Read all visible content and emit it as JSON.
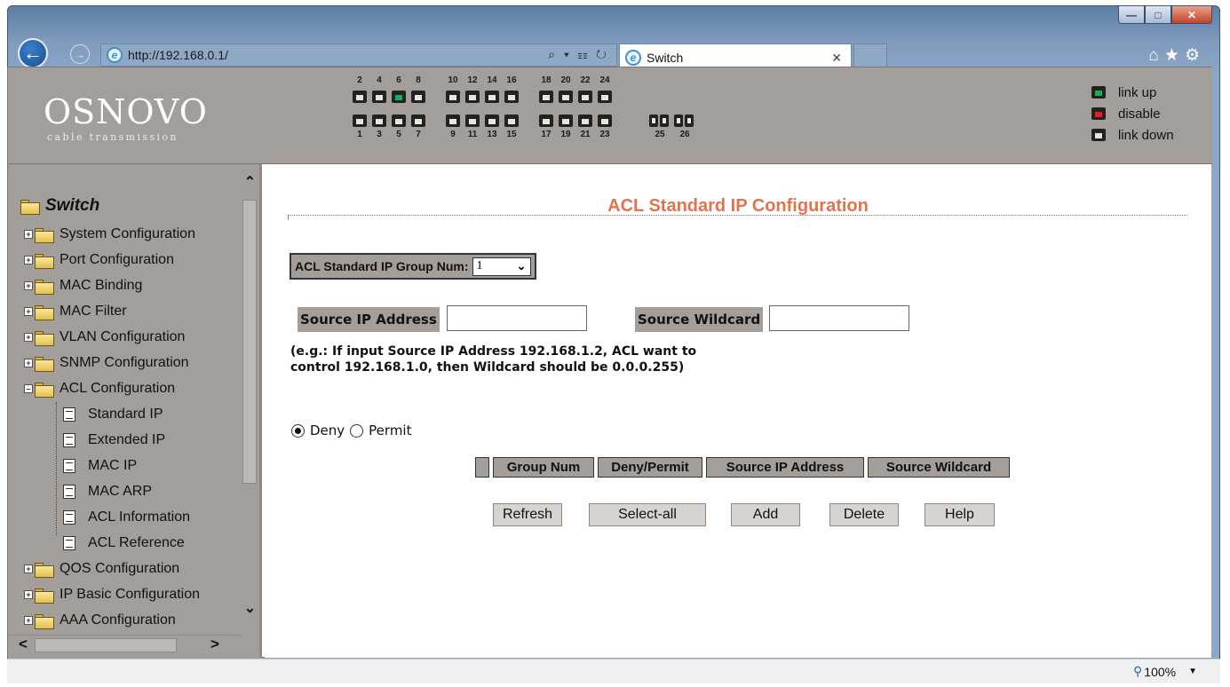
{
  "browser": {
    "url": "http://192.168.0.1/",
    "tab_title": "Switch",
    "address_tools": "⌕ ▾ ☷ ↻"
  },
  "header": {
    "logo": "OSNOVO",
    "tagline": "cable transmission",
    "ports": {
      "even": [
        "2",
        "4",
        "6",
        "8",
        "10",
        "12",
        "14",
        "16",
        "18",
        "20",
        "22",
        "24"
      ],
      "odd": [
        "1",
        "3",
        "5",
        "7",
        "9",
        "11",
        "13",
        "15",
        "17",
        "19",
        "21",
        "23"
      ],
      "fiber": [
        "25",
        "26"
      ],
      "link_up": [
        "6"
      ]
    },
    "legend": {
      "link_up": "link up",
      "disable": "disable",
      "link_down": "link down"
    },
    "colors": {
      "link_up": "#12b05a",
      "disable": "#e41c1c",
      "brand_bg": "#a39e99"
    }
  },
  "sidebar": {
    "root": "Switch",
    "items": [
      {
        "label": "System Configuration"
      },
      {
        "label": "Port Configuration"
      },
      {
        "label": "MAC Binding"
      },
      {
        "label": "MAC Filter"
      },
      {
        "label": "VLAN Configuration"
      },
      {
        "label": "SNMP Configuration"
      },
      {
        "label": "ACL Configuration"
      },
      {
        "label": "QOS Configuration"
      },
      {
        "label": "IP Basic Configuration"
      },
      {
        "label": "AAA Configuration"
      }
    ],
    "acl_children": [
      {
        "label": "Standard IP"
      },
      {
        "label": "Extended IP"
      },
      {
        "label": "MAC IP"
      },
      {
        "label": "MAC ARP"
      },
      {
        "label": "ACL Information"
      },
      {
        "label": "ACL Reference"
      }
    ]
  },
  "main": {
    "title": "ACL Standard IP Configuration",
    "group_label": "ACL Standard IP Group Num:",
    "group_value": "1",
    "source_ip_label": "Source IP Address",
    "source_ip_value": "",
    "wildcard_label": "Source Wildcard",
    "wildcard_value": "",
    "hint": "(e.g.: If input Source IP Address 192.168.1.2, ACL want to control 192.168.1.0, then Wildcard should be 0.0.0.255)",
    "radio_deny": "Deny",
    "radio_permit": "Permit",
    "selected_action": "Deny",
    "table_headers": [
      "",
      "Group Num",
      "Deny/Permit",
      "Source IP Address",
      "Source Wildcard"
    ],
    "buttons": {
      "refresh": "Refresh",
      "select_all": "Select-all",
      "add": "Add",
      "delete": "Delete",
      "help": "Help"
    }
  },
  "status": {
    "zoom": "100%"
  }
}
